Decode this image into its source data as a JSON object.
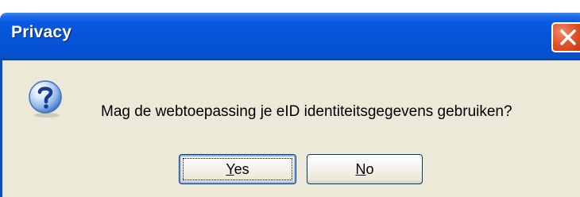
{
  "window": {
    "title": "Privacy"
  },
  "dialog": {
    "icon": "question-icon",
    "message": "Mag de webtoepassing je eID identiteitsgegevens gebruiken?",
    "buttons": {
      "yes_accel": "Y",
      "yes_rest": "es",
      "no_accel": "N",
      "no_rest": "o"
    }
  },
  "colors": {
    "titlebar": "#0654d8",
    "close": "#e2532c",
    "dialog_bg": "#ece9d8"
  }
}
